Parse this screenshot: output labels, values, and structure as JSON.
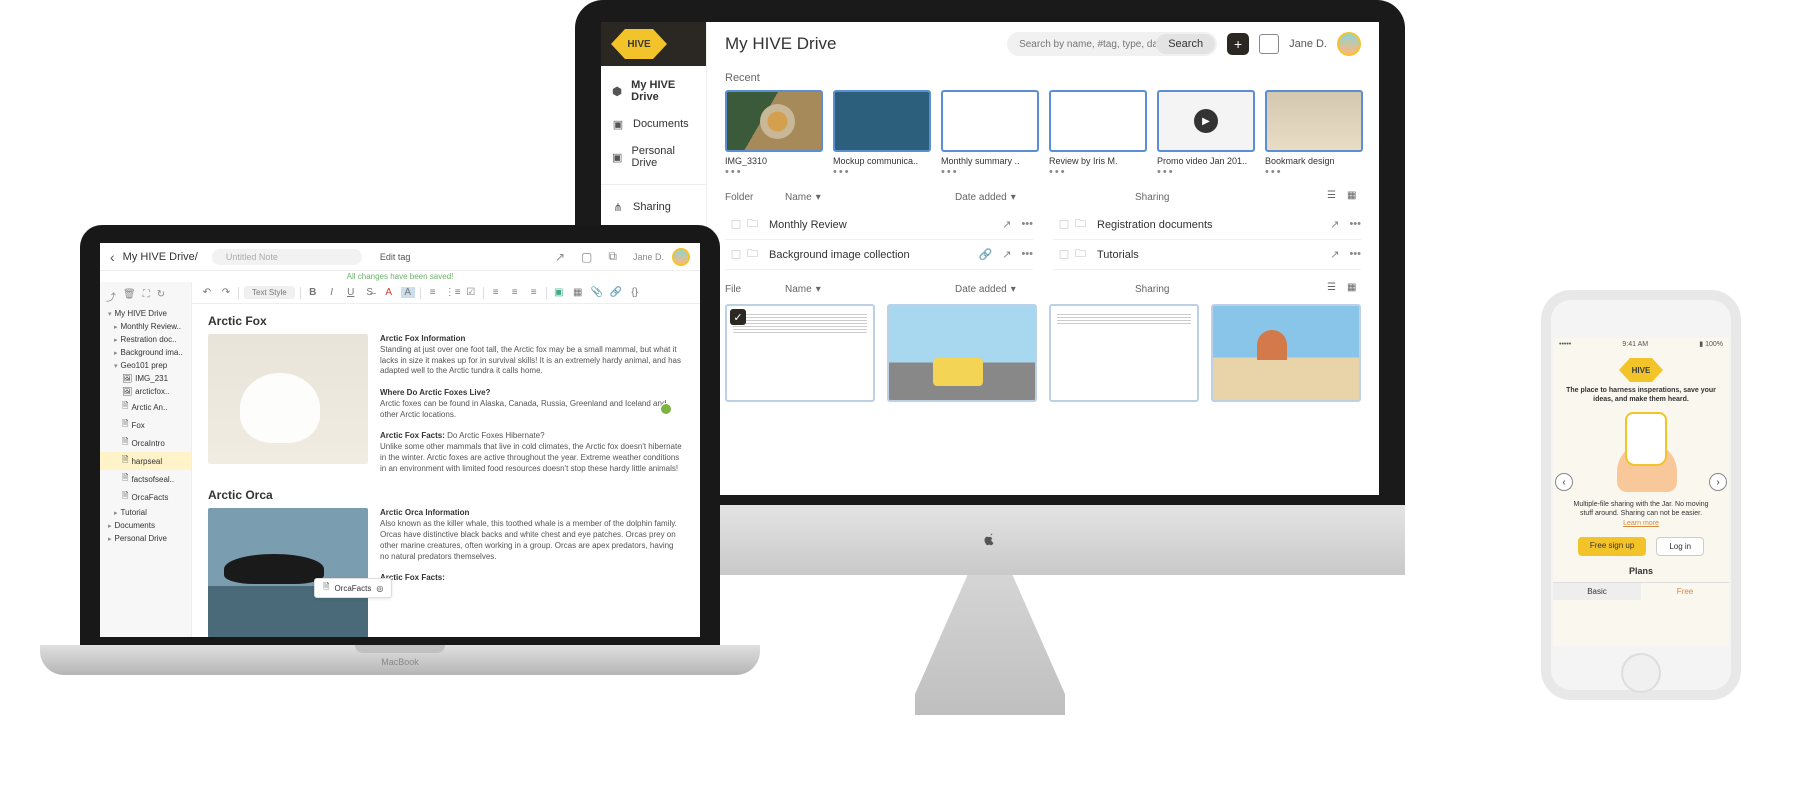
{
  "imac": {
    "logo_text": "HIVE",
    "nav": {
      "drive": "My HIVE Drive",
      "documents": "Documents",
      "personal": "Personal Drive",
      "sharing": "Sharing"
    },
    "title": "My HIVE Drive",
    "search_placeholder": "Search by name, #tag, type, date...",
    "search_btn": "Search",
    "user": "Jane D.",
    "sections": {
      "recent": "Recent",
      "folder": "Folder",
      "file": "File"
    },
    "columns": {
      "name": "Name",
      "date": "Date added",
      "sharing": "Sharing"
    },
    "recent": [
      {
        "name": "IMG_3310"
      },
      {
        "name": "Mockup communica.."
      },
      {
        "name": "Monthly summary .."
      },
      {
        "name": "Review by Iris M."
      },
      {
        "name": "Promo video Jan 201.."
      },
      {
        "name": "Bookmark design"
      }
    ],
    "folders_left": [
      {
        "name": "Monthly Review"
      },
      {
        "name": "Background image collection"
      }
    ],
    "folders_right": [
      {
        "name": "Registration documents"
      },
      {
        "name": "Tutorials"
      }
    ]
  },
  "macbook": {
    "base_label": "MacBook",
    "breadcrumb": "My HIVE Drive/",
    "note_placeholder": "Untitled Note",
    "edit_tag": "Edit tag",
    "saved_msg": "All changes have been saved!",
    "user": "Jane D.",
    "toolbar_style": "Text Style",
    "tree": {
      "root": "My HIVE Drive",
      "monthly": "Monthly Review..",
      "registration": "Restration doc..",
      "background": "Background ima..",
      "geo": "Geo101 prep",
      "img231": "IMG_231",
      "arcticfox_img": "arcticfox..",
      "arctic_an": "Arctic An..",
      "fox": "Fox",
      "orcaintro": "OrcaIntro",
      "harpseal": "harpseal",
      "factsofseal": "factsofseal..",
      "orcafacts": "OrcaFacts",
      "tutorial": "Tutorial",
      "documents": "Documents",
      "personal": "Personal Drive"
    },
    "floating_tag": "OrcaFacts",
    "content": {
      "h1": "Arctic Fox",
      "fox_info_h": "Arctic Fox Information",
      "fox_info": "Standing at just over one foot tall, the Arctic fox may be a small mammal, but what it lacks in size it makes up for in survival skills! It is an extremely hardy animal, and has adapted well to the Arctic tundra it calls home.",
      "fox_where_h": "Where Do Arctic Foxes Live?",
      "fox_where": "Arctic foxes can be found in Alaska, Canada, Russia, Greenland and Iceland and other Arctic locations.",
      "fox_facts_h": "Arctic Fox Facts:",
      "fox_facts_q": "Do Arctic Foxes Hibernate?",
      "fox_facts": "Unlike some other mammals that live in cold climates, the Arctic fox doesn't hibernate in the winter. Arctic foxes are active throughout the year. Extreme weather conditions in an environment with limited food resources doesn't stop these hardy little animals!",
      "h2": "Arctic Orca",
      "orca_info_h": "Arctic Orca Information",
      "orca_info": "Also known as the killer whale, this toothed whale is a member of the dolphin family. Orcas have distinctive black backs and white chest and eye patches. Orcas prey on other marine creatures, often working in a group. Orcas are apex predators, having no natural predators themselves.",
      "orca_facts_h": "Arctic Fox Facts:"
    }
  },
  "iphone": {
    "status_time": "9:41 AM",
    "status_batt": "100%",
    "logo_text": "HIVE",
    "tagline": "The place to harness insperations, save your ideas, and make them heard.",
    "desc": "Multiple-file sharing with the Jar. No moving stuff around. Sharing can not be easier.",
    "learn_more": "Learn more",
    "signup": "Free sign up",
    "login": "Log in",
    "plans": "Plans",
    "basic": "Basic",
    "free": "Free"
  }
}
